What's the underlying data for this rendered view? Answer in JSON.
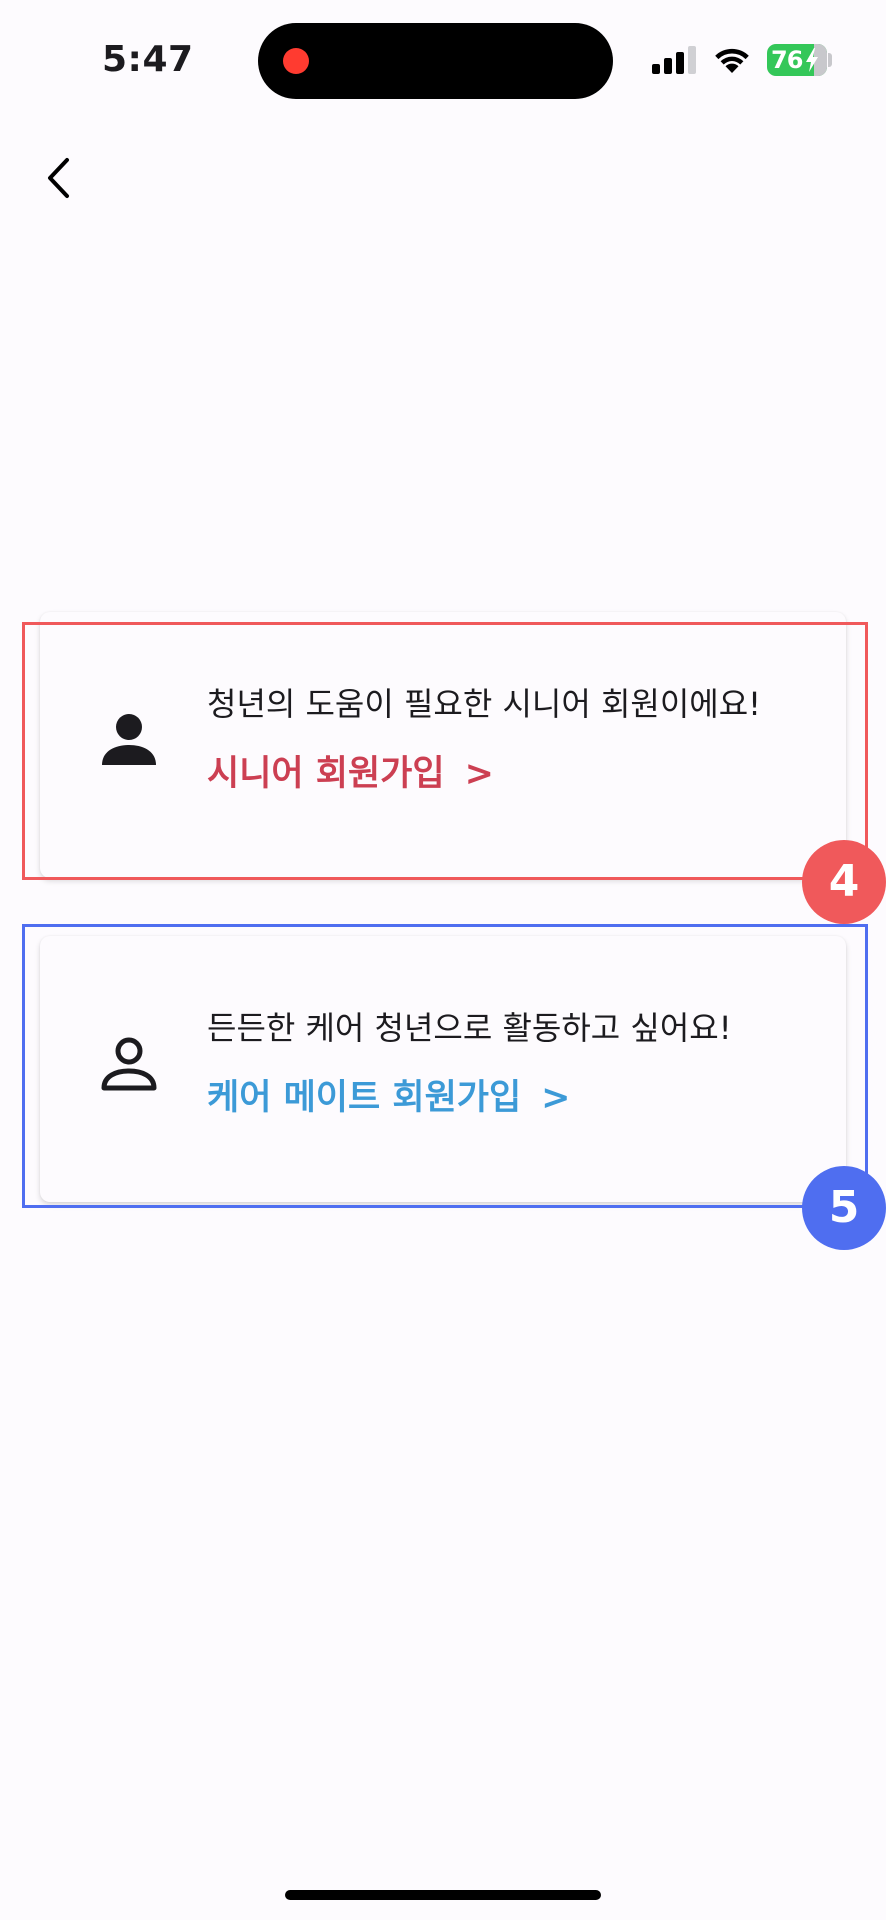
{
  "status_bar": {
    "time": "5:47",
    "battery_level": "76",
    "recording_dot_color": "#FF3B30"
  },
  "nav": {
    "back_icon": "chevron-left-icon"
  },
  "options": [
    {
      "id": "senior",
      "icon": "person-filled-icon",
      "description": "청년의 도움이 필요한 시니어 회원이에요!",
      "signup_label": "시니어 회원가입",
      "chevron": ">",
      "accent_color": "#CC3F52"
    },
    {
      "id": "care-mate",
      "icon": "person-outline-icon",
      "description": "든든한 케어 청년으로 활동하고 싶어요!",
      "signup_label": "케어 메이트 회원가입",
      "chevron": ">",
      "accent_color": "#3C9AD7"
    }
  ],
  "annotations": [
    {
      "label": "4",
      "color": "#F0595B"
    },
    {
      "label": "5",
      "color": "#4F6EF0"
    }
  ]
}
